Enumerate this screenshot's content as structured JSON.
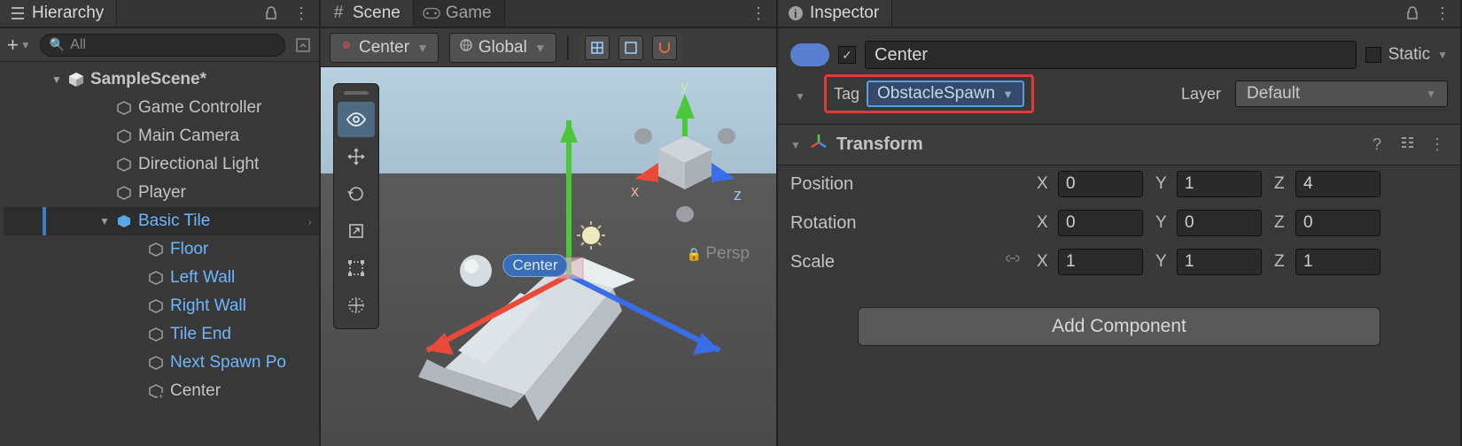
{
  "hierarchy": {
    "tab_label": "Hierarchy",
    "add_button_label": "+",
    "search_text": "All",
    "scene_name": "SampleScene*",
    "items": [
      {
        "label": "Game Controller"
      },
      {
        "label": "Main Camera"
      },
      {
        "label": "Directional Light"
      },
      {
        "label": "Player"
      },
      {
        "label": "Basic Tile"
      },
      {
        "label": "Floor"
      },
      {
        "label": "Left Wall"
      },
      {
        "label": "Right Wall"
      },
      {
        "label": "Tile End"
      },
      {
        "label": "Next Spawn Po"
      },
      {
        "label": "Center"
      }
    ]
  },
  "scene": {
    "tab_scene": "Scene",
    "tab_game": "Game",
    "pivot_mode": "Center",
    "coord_mode": "Global",
    "gizmo_x": "x",
    "gizmo_y": "y",
    "gizmo_z": "z",
    "persp_label": "Persp",
    "selected_label": "Center"
  },
  "inspector": {
    "tab_label": "Inspector",
    "go_active": true,
    "go_name": "Center",
    "static_label": "Static",
    "tag_label": "Tag",
    "tag_value": "ObstacleSpawn",
    "layer_label": "Layer",
    "layer_value": "Default",
    "transform": {
      "title": "Transform",
      "position_label": "Position",
      "rotation_label": "Rotation",
      "scale_label": "Scale",
      "position": {
        "x": "0",
        "y": "1",
        "z": "4"
      },
      "rotation": {
        "x": "0",
        "y": "0",
        "z": "0"
      },
      "scale": {
        "x": "1",
        "y": "1",
        "z": "1"
      }
    },
    "add_component_label": "Add Component"
  }
}
